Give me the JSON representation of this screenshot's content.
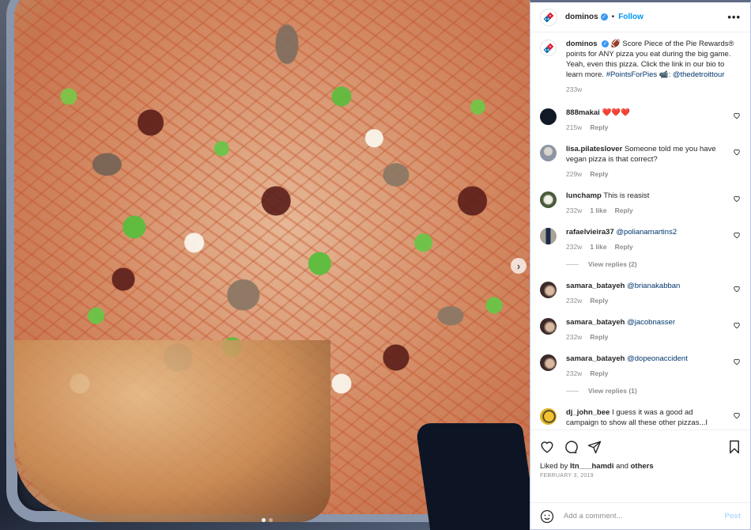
{
  "photo": {
    "description": "Square pizza with mushrooms, green peppers, onions and sausage on a metal tray",
    "carousel": {
      "total": 2,
      "active": 1
    },
    "next_icon": "chevron-right-icon"
  },
  "header": {
    "username": "dominos",
    "verified": true,
    "separator": "•",
    "follow_label": "Follow",
    "more_icon": "•••"
  },
  "caption": {
    "username": "dominos",
    "verified": true,
    "emoji": "🏈",
    "text": " Score Piece of the Pie Rewards® points for ANY pizza you eat during the big game. Yeah, even this pizza. Click the link in our bio to learn more. ",
    "hashtag": "#PointsForPies",
    "camera_emoji": "📹:",
    "mention": "@thedetroittour",
    "age": "233w"
  },
  "comments": [
    {
      "username": "888makai",
      "text": "❤️❤️❤️",
      "mention": "",
      "age": "215w",
      "likes": "",
      "reply_label": "Reply",
      "avatar_color": "#0f1a26"
    },
    {
      "username": "lisa.pilateslover",
      "text": "Someone told me you have vegan pizza is that correct?",
      "mention": "",
      "age": "229w",
      "likes": "",
      "reply_label": "Reply",
      "avatar_color": "#8b95a3"
    },
    {
      "username": "lunchamp",
      "text": "This is reasist",
      "mention": "",
      "age": "232w",
      "likes": "1 like",
      "reply_label": "Reply",
      "avatar_color": "#4a5a3a"
    },
    {
      "username": "rafaelvieira37",
      "text": "",
      "mention": "@polianamartins2",
      "age": "232w",
      "likes": "1 like",
      "reply_label": "Reply",
      "avatar_color": "#6f6a5f",
      "view_replies": "View replies (2)"
    },
    {
      "username": "samara_batayeh",
      "text": "",
      "mention": "@brianakabban",
      "age": "232w",
      "likes": "",
      "reply_label": "Reply",
      "avatar_color": "#6d4a3e"
    },
    {
      "username": "samara_batayeh",
      "text": "",
      "mention": "@jacobnasser",
      "age": "232w",
      "likes": "",
      "reply_label": "Reply",
      "avatar_color": "#6d4a3e"
    },
    {
      "username": "samara_batayeh",
      "text": "",
      "mention": "@dopeonaccident",
      "age": "232w",
      "likes": "",
      "reply_label": "Reply",
      "avatar_color": "#6d4a3e",
      "view_replies": "View replies (1)"
    },
    {
      "username": "dj_john_bee",
      "text": "I guess it was a good ad campaign to show all these other pizzas...I guess ugg.",
      "mention": "",
      "age": "233w",
      "likes": "",
      "reply_label": "Reply",
      "avatar_color": "#e2b52b"
    }
  ],
  "actions": {
    "like_icon": "heart-icon",
    "comment_icon": "comment-icon",
    "share_icon": "send-icon",
    "save_icon": "bookmark-icon",
    "liked_by_prefix": "Liked by ",
    "liked_by_user": "ltn___hamdi",
    "liked_by_and": " and ",
    "liked_by_others": "others",
    "date": "FEBRUARY 3, 2019"
  },
  "add_comment": {
    "placeholder": "Add a comment...",
    "post_label": "Post",
    "emoji_icon": "smiley-icon"
  },
  "colors": {
    "link": "#00376b",
    "follow": "#0095f6",
    "verified": "#3897f0",
    "muted": "#8e8e8e",
    "post_disabled": "#b3dbff"
  }
}
